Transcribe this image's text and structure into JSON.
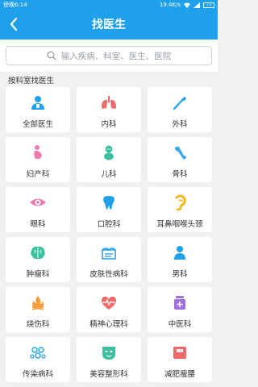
{
  "status_bar": {
    "time": "傍晚6:14",
    "speed": "19.4K/s",
    "battery": "73"
  },
  "header": {
    "title": "找医生",
    "back_icon": "chevron-left-icon"
  },
  "search": {
    "placeholder": "输入疾病、科室、医生、医院"
  },
  "section_title": "按科室找医生",
  "departments": [
    {
      "label": "全部医生",
      "icon": "doctor-icon",
      "color": "#1fa0ea"
    },
    {
      "label": "内科",
      "icon": "lungs-icon",
      "color": "#f06a6a"
    },
    {
      "label": "外科",
      "icon": "scalpel-icon",
      "color": "#1fa0ea"
    },
    {
      "label": "妇产科",
      "icon": "pregnant-icon",
      "color": "#f07ab0"
    },
    {
      "label": "儿科",
      "icon": "baby-icon",
      "color": "#3cc0a0"
    },
    {
      "label": "骨科",
      "icon": "bone-icon",
      "color": "#1fa0ea"
    },
    {
      "label": "眼科",
      "icon": "eye-icon",
      "color": "#f07ab0"
    },
    {
      "label": "口腔科",
      "icon": "tooth-icon",
      "color": "#1fa0ea"
    },
    {
      "label": "耳鼻咽喉头颈",
      "icon": "ear-icon",
      "color": "#f5b820"
    },
    {
      "label": "肿瘤科",
      "icon": "brain-icon",
      "color": "#3cc0a0"
    },
    {
      "label": "皮肤性病科",
      "icon": "skin-icon",
      "color": "#1fa0ea"
    },
    {
      "label": "男科",
      "icon": "male-icon",
      "color": "#1fa0ea"
    },
    {
      "label": "烧伤科",
      "icon": "fire-icon",
      "color": "#f5a040"
    },
    {
      "label": "精神心理科",
      "icon": "heartbeat-icon",
      "color": "#f06a6a"
    },
    {
      "label": "中医科",
      "icon": "medicine-jar-icon",
      "color": "#a070e0"
    },
    {
      "label": "传染病科",
      "icon": "virus-icon",
      "color": "#1fa0ea"
    },
    {
      "label": "美容整形科",
      "icon": "face-mask-icon",
      "color": "#3cc0a0"
    },
    {
      "label": "减肥瘦腰",
      "icon": "scale-icon",
      "color": "#f06a6a"
    }
  ]
}
